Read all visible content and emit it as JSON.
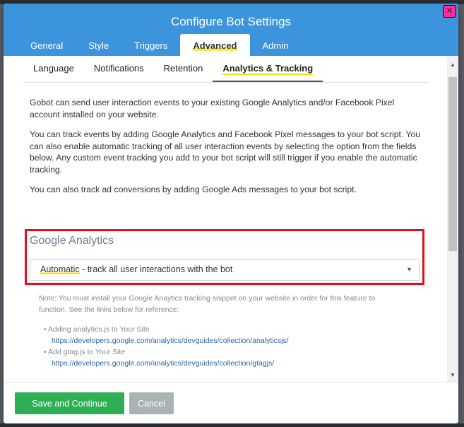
{
  "dialog": {
    "title": "Configure Bot Settings",
    "close_icon": "close-icon"
  },
  "tabs": [
    {
      "label": "General"
    },
    {
      "label": "Style"
    },
    {
      "label": "Triggers"
    },
    {
      "label": "Advanced",
      "active": true
    },
    {
      "label": "Admin"
    }
  ],
  "subtabs": [
    {
      "label": "Language"
    },
    {
      "label": "Notifications"
    },
    {
      "label": "Retention"
    },
    {
      "label": "Analytics & Tracking",
      "active": true
    }
  ],
  "content": {
    "para1": "Gobot can send user interaction events to your existing Google Analytics and/or Facebook Pixel account installed on your website.",
    "para2": "You can track events by adding Google Analytics and Facebook Pixel messages to your bot script. You can also enable automatic tracking of all user interaction events by selecting the option from the fields below. Any custom event tracking you add to your bot script will still trigger if you enable the automatic tracking.",
    "para3": "You can also track ad conversions by adding Google Ads messages to your bot script."
  },
  "google_analytics": {
    "section_title": "Google Analytics",
    "select_value": "Automatic",
    "select_suffix": " - track all user interactions with the bot",
    "note": "Note: You must install your Google Anaytics tracking snippet on your website in order for this feature to function. See the links below for reference:",
    "links": [
      {
        "label": "Adding analytics.js to Your Site",
        "url": "https://developers.google.com/analytics/devguides/collection/analyticsjs/"
      },
      {
        "label": "Add gtag.js to Your Site",
        "url": "https://developers.google.com/analytics/devguides/collection/gtagjs/"
      }
    ]
  },
  "footer": {
    "save_label": "Save and Continue",
    "cancel_label": "Cancel"
  },
  "colors": {
    "header": "#3c95dc",
    "primary_button": "#2eae55",
    "highlight_box": "#e3101b"
  }
}
